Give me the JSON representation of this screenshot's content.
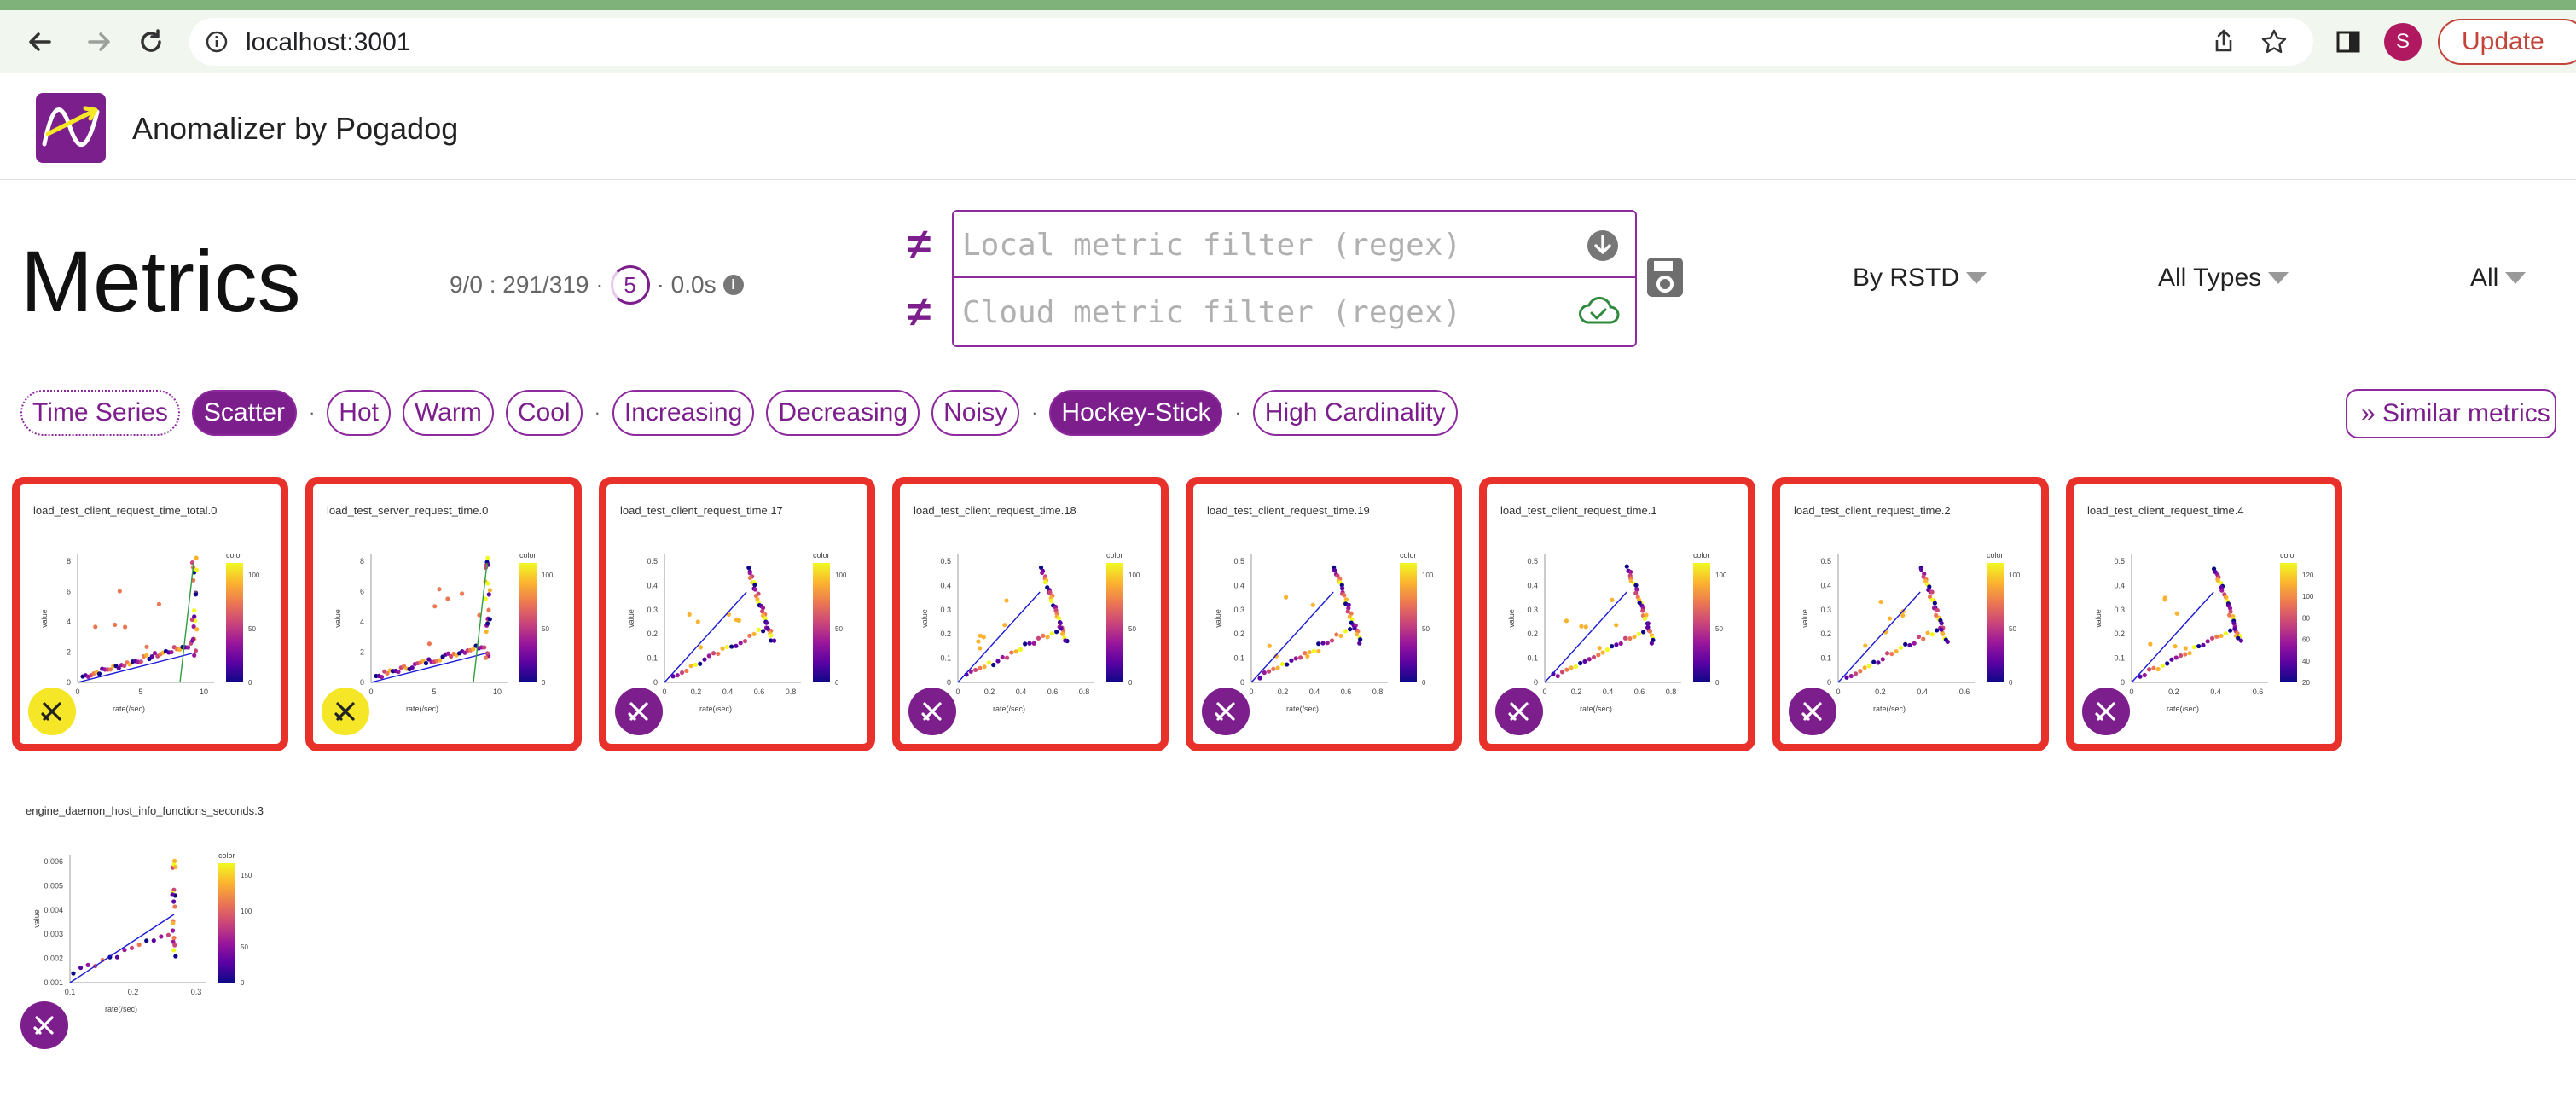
{
  "browser": {
    "url": "localhost:3001",
    "avatar_letter": "S",
    "update_label": "Update"
  },
  "app": {
    "title": "Anomalizer by Pogadog"
  },
  "page_title": "Metrics",
  "stats": {
    "counts": "9/0 : 291/319 ·",
    "ring_value": "5",
    "timing": "· 0.0s",
    "info_glyph": "i"
  },
  "filters": {
    "neq_glyph": "≠",
    "local_placeholder": "Local metric filter (regex)",
    "cloud_placeholder": "Cloud metric filter (regex)"
  },
  "dropdowns": {
    "sort": "By RSTD",
    "types": "All Types",
    "scope": "All"
  },
  "chips": [
    {
      "label": "Time Series",
      "style": "dotted"
    },
    {
      "label": "Scatter",
      "style": "selected"
    },
    {
      "sep": "·"
    },
    {
      "label": "Hot",
      "style": "normal"
    },
    {
      "label": "Warm",
      "style": "normal"
    },
    {
      "label": "Cool",
      "style": "normal"
    },
    {
      "sep": "·"
    },
    {
      "label": "Increasing",
      "style": "normal"
    },
    {
      "label": "Decreasing",
      "style": "normal"
    },
    {
      "label": "Noisy",
      "style": "normal"
    },
    {
      "sep": "·"
    },
    {
      "label": "Hockey-Stick",
      "style": "selected"
    },
    {
      "sep": "·"
    },
    {
      "label": "High Cardinality",
      "style": "normal"
    }
  ],
  "similar_button": "» Similar metrics",
  "colors": {
    "accent": "#7d1e8d",
    "alert_border": "#e8312a",
    "badge_yellow": "#f5e728"
  },
  "cards": [
    {
      "title": "load_test_client_request_time_total.0",
      "kind": "hockey",
      "badge": "yellow-cross-icon",
      "x_ticks": [
        "0",
        "5",
        "10"
      ],
      "y_ticks": [
        "0",
        "2",
        "4",
        "6",
        "8"
      ],
      "cb_ticks": [
        "100",
        "50",
        "0"
      ],
      "xlabel": "rate(/sec)",
      "ylabel": "value",
      "cb_label": "color"
    },
    {
      "title": "load_test_server_request_time.0",
      "kind": "hockey",
      "badge": "yellow-cross-icon",
      "x_ticks": [
        "0",
        "5",
        "10"
      ],
      "y_ticks": [
        "0",
        "2",
        "4",
        "6",
        "8"
      ],
      "cb_ticks": [
        "100",
        "50",
        "0"
      ],
      "xlabel": "rate(/sec)",
      "ylabel": "value",
      "cb_label": "color"
    },
    {
      "title": "load_test_client_request_time.17",
      "kind": "loop",
      "badge": "purple-cross-icon",
      "x_ticks": [
        "0",
        "0.2",
        "0.4",
        "0.6",
        "0.8"
      ],
      "y_ticks": [
        "0",
        "0.1",
        "0.2",
        "0.3",
        "0.4",
        "0.5"
      ],
      "cb_ticks": [
        "100",
        "50",
        "0"
      ],
      "xlabel": "rate(/sec)",
      "ylabel": "value",
      "cb_label": "color"
    },
    {
      "title": "load_test_client_request_time.18",
      "kind": "loop",
      "badge": "purple-cross-icon",
      "x_ticks": [
        "0",
        "0.2",
        "0.4",
        "0.6",
        "0.8"
      ],
      "y_ticks": [
        "0",
        "0.1",
        "0.2",
        "0.3",
        "0.4",
        "0.5"
      ],
      "cb_ticks": [
        "100",
        "50",
        "0"
      ],
      "xlabel": "rate(/sec)",
      "ylabel": "value",
      "cb_label": "color"
    },
    {
      "title": "load_test_client_request_time.19",
      "kind": "loop",
      "badge": "purple-cross-icon",
      "x_ticks": [
        "0",
        "0.2",
        "0.4",
        "0.6",
        "0.8"
      ],
      "y_ticks": [
        "0",
        "0.1",
        "0.2",
        "0.3",
        "0.4",
        "0.5"
      ],
      "cb_ticks": [
        "100",
        "50",
        "0"
      ],
      "xlabel": "rate(/sec)",
      "ylabel": "value",
      "cb_label": "color"
    },
    {
      "title": "load_test_client_request_time.1",
      "kind": "loop",
      "badge": "purple-cross-icon",
      "x_ticks": [
        "0",
        "0.2",
        "0.4",
        "0.6",
        "0.8"
      ],
      "y_ticks": [
        "0",
        "0.1",
        "0.2",
        "0.3",
        "0.4",
        "0.5"
      ],
      "cb_ticks": [
        "100",
        "50",
        "0"
      ],
      "xlabel": "rate(/sec)",
      "ylabel": "value",
      "cb_label": "color"
    },
    {
      "title": "load_test_client_request_time.2",
      "kind": "loop",
      "badge": "purple-cross-icon",
      "x_ticks": [
        "0",
        "0.2",
        "0.4",
        "0.6"
      ],
      "y_ticks": [
        "0",
        "0.1",
        "0.2",
        "0.3",
        "0.4",
        "0.5"
      ],
      "cb_ticks": [
        "100",
        "50",
        "0"
      ],
      "xlabel": "rate(/sec)",
      "ylabel": "value",
      "cb_label": "color"
    },
    {
      "title": "load_test_client_request_time.4",
      "kind": "loop",
      "badge": "purple-cross-icon",
      "x_ticks": [
        "0",
        "0.2",
        "0.4",
        "0.6"
      ],
      "y_ticks": [
        "0",
        "0.1",
        "0.2",
        "0.3",
        "0.4",
        "0.5"
      ],
      "cb_ticks": [
        "120",
        "100",
        "80",
        "60",
        "40",
        "20"
      ],
      "xlabel": "rate(/sec)",
      "ylabel": "value",
      "cb_label": "color"
    },
    {
      "title": "engine_daemon_host_info_functions_seconds.3",
      "kind": "linear",
      "badge": "purple-cross-icon",
      "x_ticks": [
        "0.1",
        "0.2",
        "0.3"
      ],
      "y_ticks": [
        "0.001",
        "0.002",
        "0.003",
        "0.004",
        "0.005",
        "0.006"
      ],
      "cb_ticks": [
        "150",
        "100",
        "50",
        "0"
      ],
      "xlabel": "rate(/sec)",
      "ylabel": "value",
      "cb_label": "color"
    }
  ]
}
